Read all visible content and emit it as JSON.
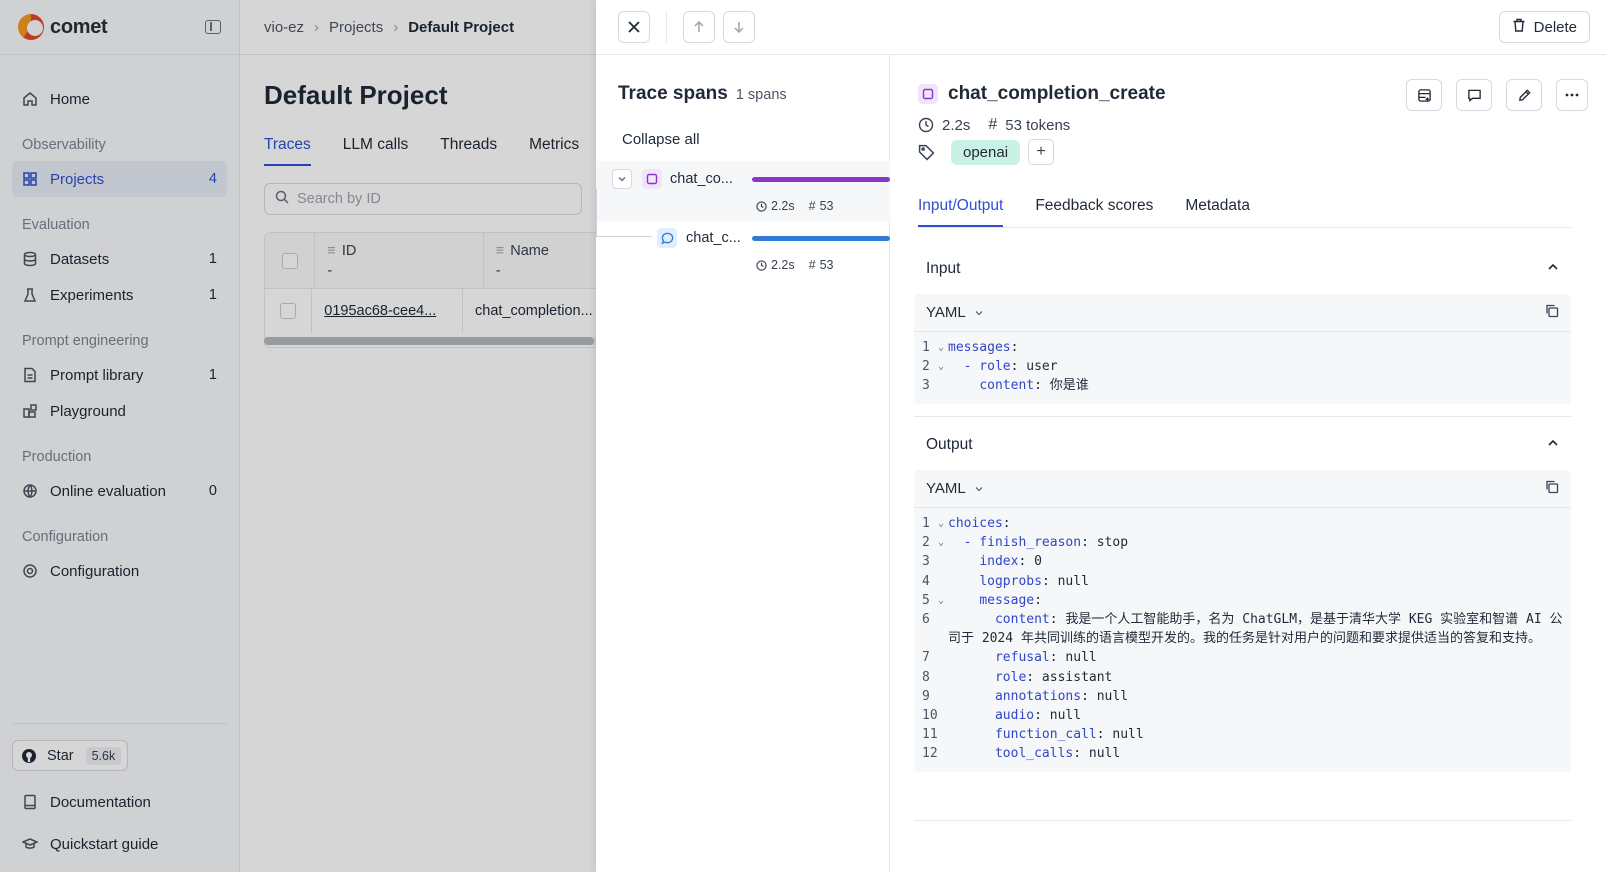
{
  "app": {
    "name": "comet"
  },
  "sidebar": {
    "home": "Home",
    "sections": {
      "observability": "Observability",
      "evaluation": "Evaluation",
      "prompt_engineering": "Prompt engineering",
      "production": "Production",
      "configuration": "Configuration"
    },
    "items": {
      "projects": {
        "label": "Projects",
        "count": "4"
      },
      "datasets": {
        "label": "Datasets",
        "count": "1"
      },
      "experiments": {
        "label": "Experiments",
        "count": "1"
      },
      "prompt_library": {
        "label": "Prompt library",
        "count": "1"
      },
      "playground": {
        "label": "Playground"
      },
      "online_evaluation": {
        "label": "Online evaluation",
        "count": "0"
      },
      "configuration": {
        "label": "Configuration"
      }
    },
    "star": {
      "label": "Star",
      "count": "5.6k"
    },
    "documentation": "Documentation",
    "quickstart": "Quickstart guide"
  },
  "breadcrumb": [
    "vio-ez",
    "Projects",
    "Default Project"
  ],
  "page": {
    "title": "Default Project",
    "tabs": [
      "Traces",
      "LLM calls",
      "Threads",
      "Metrics"
    ],
    "search_placeholder": "Search by ID",
    "table": {
      "headers": [
        {
          "label": "ID",
          "sub": "-"
        },
        {
          "label": "Name",
          "sub": "-"
        }
      ],
      "rows": [
        {
          "id": "0195ac68-cee4...",
          "name": "chat_completion..."
        }
      ]
    }
  },
  "panel": {
    "delete_label": "Delete",
    "spans_title": "Trace spans",
    "spans_count": "1 spans",
    "collapse_all": "Collapse all",
    "spans": [
      {
        "name": "chat_co...",
        "duration": "2.2s",
        "tokens": "53"
      },
      {
        "name": "chat_c...",
        "duration": "2.2s",
        "tokens": "53"
      }
    ],
    "detail": {
      "title": "chat_completion_create",
      "duration": "2.2s",
      "tokens": "53 tokens",
      "tag": "openai",
      "add_tag": "+",
      "tabs": [
        "Input/Output",
        "Feedback scores",
        "Metadata"
      ],
      "input": {
        "label": "Input",
        "format": "YAML",
        "lines": [
          {
            "n": "1",
            "k": "messages",
            "v": ""
          },
          {
            "n": "2",
            "k": "- role",
            "v": " user"
          },
          {
            "n": "3",
            "k": "content",
            "v": " 你是谁"
          }
        ]
      },
      "output": {
        "label": "Output",
        "format": "YAML",
        "lines": [
          {
            "n": "1",
            "k": "choices",
            "v": ""
          },
          {
            "n": "2",
            "k": "- finish_reason",
            "v": " stop"
          },
          {
            "n": "3",
            "k": "index",
            "v": " 0"
          },
          {
            "n": "4",
            "k": "logprobs",
            "v": " null"
          },
          {
            "n": "5",
            "k": "message",
            "v": ""
          },
          {
            "n": "6",
            "k": "content",
            "v": " 我是一个人工智能助手，名为 ChatGLM，是基于清华大学 KEG 实验室和智谱 AI 公司于 2024 年共同训练的语言模型开发的。我的任务是针对用户的问题和要求提供适当的答复和支持。"
          },
          {
            "n": "7",
            "k": "refusal",
            "v": " null"
          },
          {
            "n": "8",
            "k": "role",
            "v": " assistant"
          },
          {
            "n": "9",
            "k": "annotations",
            "v": " null"
          },
          {
            "n": "10",
            "k": "audio",
            "v": " null"
          },
          {
            "n": "11",
            "k": "function_call",
            "v": " null"
          },
          {
            "n": "12",
            "k": "tool_calls",
            "v": " null"
          }
        ]
      }
    }
  },
  "colors": {
    "accent": "#2f4fcf",
    "tag_bg": "#c9f2e4",
    "span_bar_1": "#8b35c9",
    "span_bar_2": "#2f7bd6"
  }
}
